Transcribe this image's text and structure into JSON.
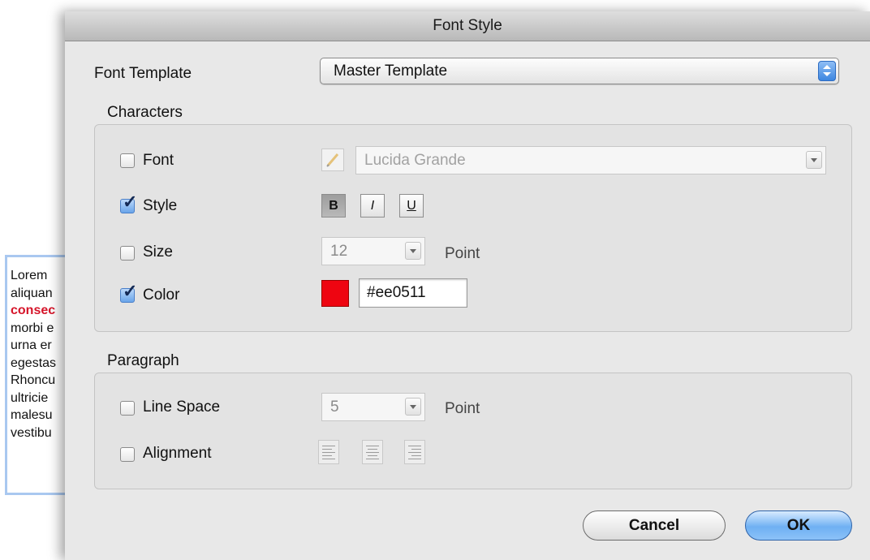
{
  "background_doc": {
    "lines": [
      "Lorem",
      "aliquan",
      "consec",
      "morbi e",
      "urna er",
      "egestas",
      "Rhoncu",
      "ultricie",
      "malesu",
      "vestibu"
    ],
    "highlight_color": "#d6152a"
  },
  "dialog": {
    "title": "Font Style",
    "font_template": {
      "label": "Font Template",
      "selected": "Master Template"
    },
    "characters": {
      "legend": "Characters",
      "font": {
        "label": "Font",
        "checked": false,
        "value": "Lucida Grande",
        "icon": "pencil-icon"
      },
      "style": {
        "label": "Style",
        "checked": true,
        "bold": "B",
        "italic": "I",
        "underline": "U",
        "bold_active": true
      },
      "size": {
        "label": "Size",
        "checked": false,
        "value": "12",
        "unit": "Point"
      },
      "color": {
        "label": "Color",
        "checked": true,
        "hex": "#ee0511",
        "swatch": "#ee0511"
      }
    },
    "paragraph": {
      "legend": "Paragraph",
      "line_space": {
        "label": "Line Space",
        "checked": false,
        "value": "5",
        "unit": "Point"
      },
      "alignment": {
        "label": "Alignment",
        "checked": false,
        "options": [
          "align-left-icon",
          "align-center-icon",
          "align-right-icon"
        ]
      }
    },
    "buttons": {
      "cancel": "Cancel",
      "ok": "OK"
    }
  }
}
